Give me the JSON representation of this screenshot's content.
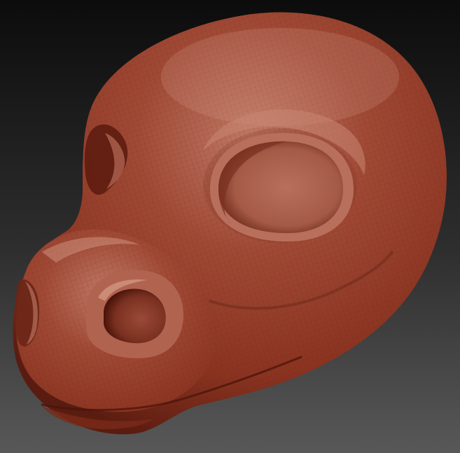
{
  "scene": {
    "subject_icon": "sculpted-animal-head-model",
    "colors": {
      "bg_top": "#0c0c0c",
      "bg_bottom": "#585858",
      "clay_base": "#8a3320",
      "clay_mid": "#a04a36",
      "clay_light": "#c07a66",
      "clay_highlight": "#d8a08c",
      "clay_shadow": "#4a140a",
      "wire": "#5a1c10"
    }
  }
}
